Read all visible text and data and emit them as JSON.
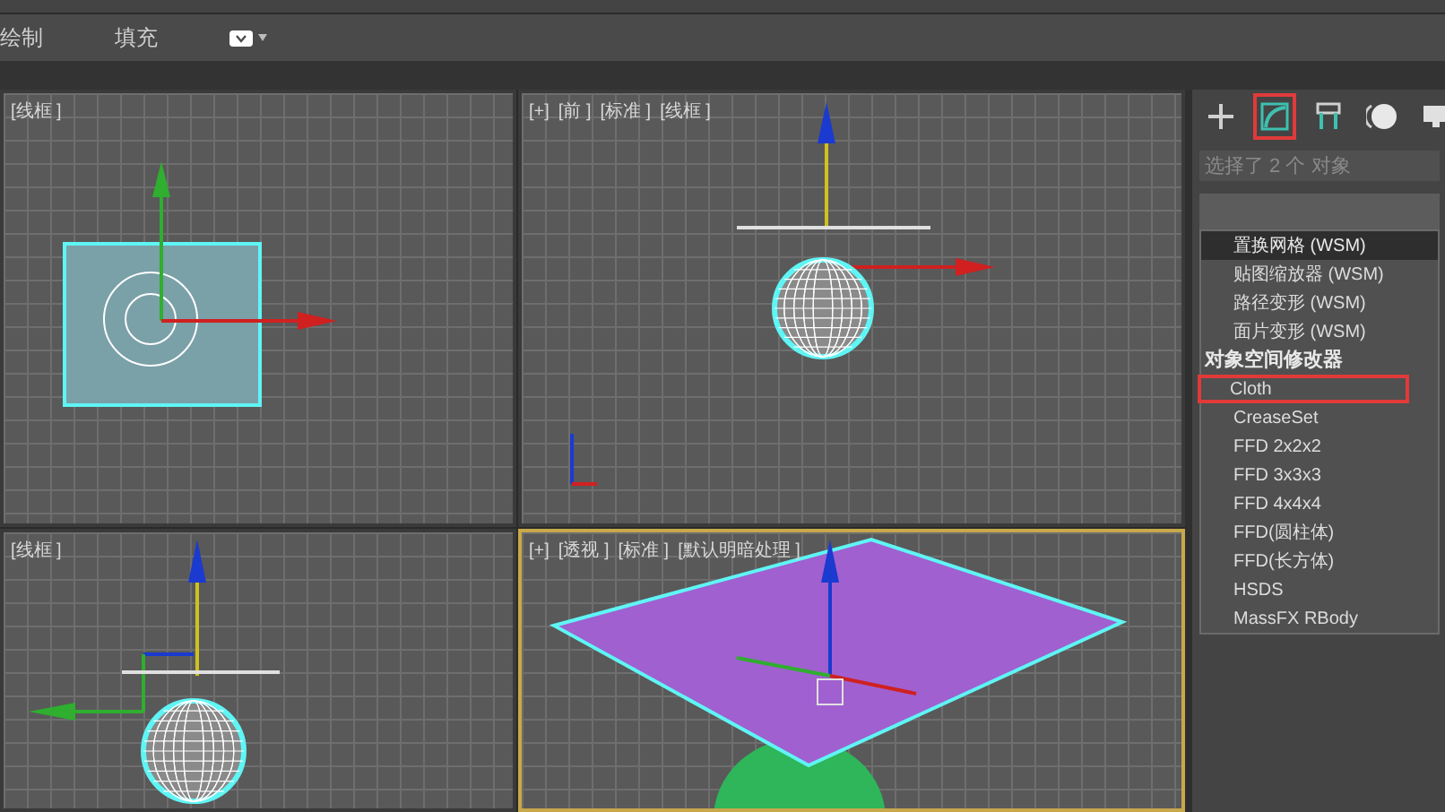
{
  "ribbon": {
    "tabs": [
      {
        "label": "绘制"
      },
      {
        "label": "填充"
      }
    ]
  },
  "viewports": [
    {
      "kind": "top",
      "labels": [
        "[线框 ]"
      ],
      "active": false
    },
    {
      "kind": "front",
      "labels": [
        "[+]",
        "[前 ]",
        "[标准 ]",
        "[线框 ]"
      ],
      "active": false
    },
    {
      "kind": "left",
      "labels": [
        "[线框 ]"
      ],
      "active": false
    },
    {
      "kind": "perspective",
      "labels": [
        "[+]",
        "[透视 ]",
        "[标准 ]",
        "[默认明暗处理 ]"
      ],
      "active": true
    }
  ],
  "command_panel": {
    "tabs": [
      {
        "kind": "create",
        "selected": false
      },
      {
        "kind": "modify",
        "selected": true
      },
      {
        "kind": "hierarchy",
        "selected": false
      },
      {
        "kind": "motion",
        "selected": false
      },
      {
        "kind": "display",
        "selected": false
      }
    ],
    "selection_field": {
      "value": "选择了 2 个 对象"
    },
    "modifier_list": [
      {
        "kind": "item",
        "label": "置换网格 (WSM)",
        "selected": true,
        "highlighted": false
      },
      {
        "kind": "item",
        "label": "贴图缩放器 (WSM)",
        "selected": false,
        "highlighted": false
      },
      {
        "kind": "item",
        "label": "路径变形 (WSM)",
        "selected": false,
        "highlighted": false
      },
      {
        "kind": "item",
        "label": "面片变形 (WSM)",
        "selected": false,
        "highlighted": false
      },
      {
        "kind": "header",
        "label": "对象空间修改器"
      },
      {
        "kind": "item",
        "label": "Cloth",
        "selected": false,
        "highlighted": true
      },
      {
        "kind": "item",
        "label": "CreaseSet",
        "selected": false,
        "highlighted": false
      },
      {
        "kind": "item",
        "label": "FFD 2x2x2",
        "selected": false,
        "highlighted": false
      },
      {
        "kind": "item",
        "label": "FFD 3x3x3",
        "selected": false,
        "highlighted": false
      },
      {
        "kind": "item",
        "label": "FFD 4x4x4",
        "selected": false,
        "highlighted": false
      },
      {
        "kind": "item",
        "label": "FFD(圆柱体)",
        "selected": false,
        "highlighted": false
      },
      {
        "kind": "item",
        "label": "FFD(长方体)",
        "selected": false,
        "highlighted": false
      },
      {
        "kind": "item",
        "label": "HSDS",
        "selected": false,
        "highlighted": false
      },
      {
        "kind": "item",
        "label": "MassFX RBody",
        "selected": false,
        "highlighted": false
      }
    ]
  }
}
